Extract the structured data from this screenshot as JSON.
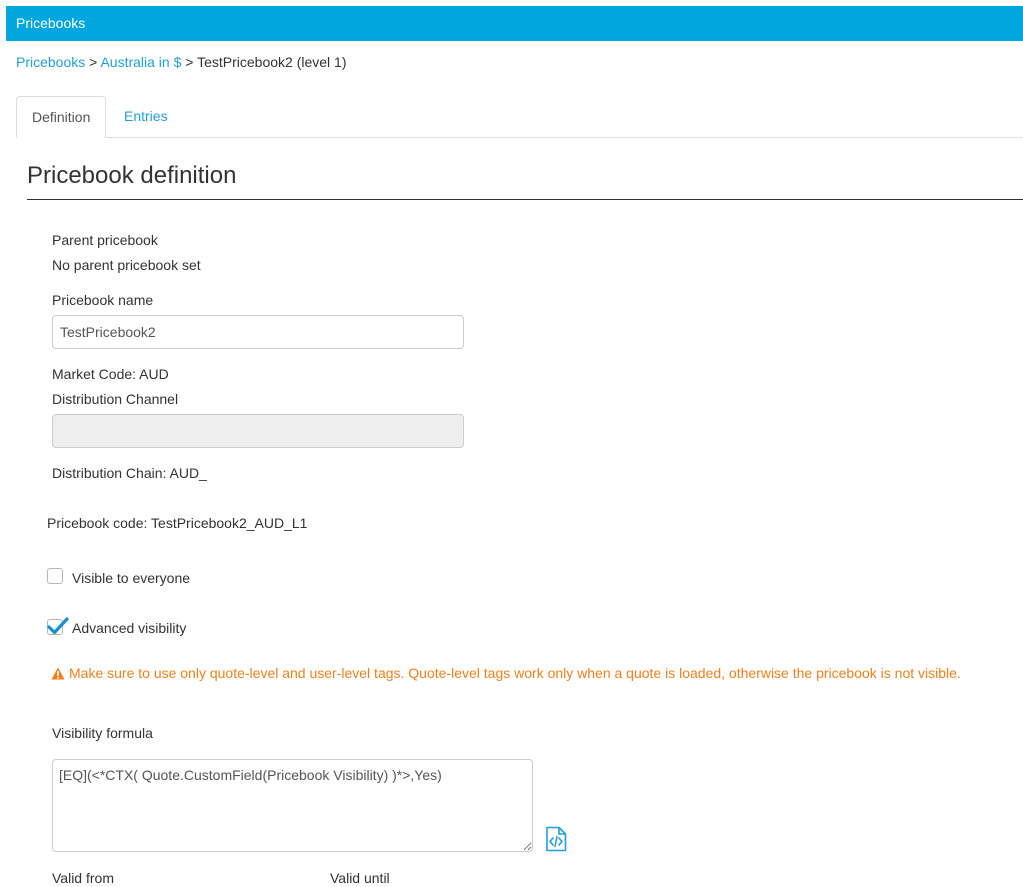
{
  "header": {
    "title": "Pricebooks"
  },
  "breadcrumb": {
    "root": "Pricebooks",
    "sep1": " > ",
    "market": "Australia in $",
    "sep2": " > ",
    "current": "TestPricebook2 (level 1)"
  },
  "tabs": [
    {
      "label": "Definition",
      "active": true
    },
    {
      "label": "Entries",
      "active": false
    }
  ],
  "section": {
    "title": "Pricebook definition"
  },
  "form": {
    "parent_label": "Parent pricebook",
    "parent_value": "No parent pricebook set",
    "name_label": "Pricebook name",
    "name_value": "TestPricebook2",
    "market_code": "Market Code: AUD",
    "distribution_channel_label": "Distribution Channel",
    "distribution_channel_value": "",
    "distribution_chain": "Distribution Chain: AUD_",
    "pricebook_code": "Pricebook code: TestPricebook2_AUD_L1",
    "visible_everyone_label": "Visible to everyone",
    "visible_everyone_checked": false,
    "advanced_visibility_label": "Advanced visibility",
    "advanced_visibility_checked": true,
    "warning": "Make sure to use only quote-level and user-level tags. Quote-level tags work only when a quote is loaded, otherwise the pricebook is not visible.",
    "formula_label": "Visibility formula",
    "formula_value": "[EQ](<*CTX( Quote.CustomField(Pricebook Visibility) )*>,Yes)",
    "valid_from_label": "Valid from",
    "valid_until_label": "Valid until"
  },
  "colors": {
    "header_bg": "#00a6de",
    "link": "#1ea1d9",
    "warning": "#f0801a",
    "checkbox_check": "#1a8fd6"
  },
  "icons": {
    "warning": "warning-triangle-icon",
    "checkmark": "checkmark-icon",
    "code_editor": "code-file-icon"
  }
}
